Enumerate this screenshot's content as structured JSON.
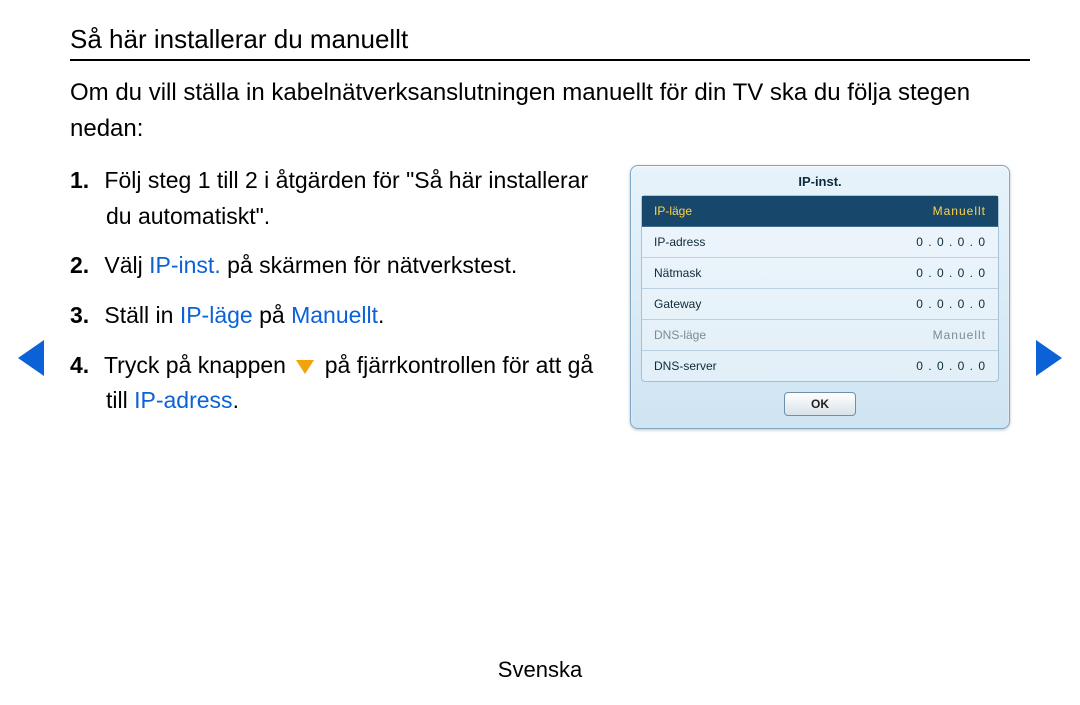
{
  "title": "Så här installerar du manuellt",
  "intro": "Om du vill ställa in kabelnätverksanslutningen manuellt för din TV ska du följja stegen nedan:",
  "intro_fixed": "Om du vill ställa in kabelnätverksanslutningen manuellt för din TV ska du följa stegen nedan:",
  "steps": {
    "s1": "Följ steg 1 till 2 i åtgärden för \"Så här installerar du automatiskt\".",
    "s2_pre": "Välj ",
    "s2_hl": "IP-inst.",
    "s2_post": " på skärmen för nätverkstest.",
    "s3_pre": "Ställ in ",
    "s3_hl1": "IP-läge",
    "s3_mid": " på ",
    "s3_hl2": "Manuellt",
    "s3_post": ".",
    "s4_pre": "Tryck på knappen ",
    "s4_mid": " på fjärrkontrollen för att gå till ",
    "s4_hl": "IP-adress",
    "s4_post": "."
  },
  "panel": {
    "title": "IP-inst.",
    "rows": [
      {
        "label": "IP-läge",
        "value": "Manuellt",
        "selected": true
      },
      {
        "label": "IP-adress",
        "value": "0 . 0 . 0 . 0"
      },
      {
        "label": "Nätmask",
        "value": "0 . 0 . 0 . 0"
      },
      {
        "label": "Gateway",
        "value": "0 . 0 . 0 . 0"
      },
      {
        "label": "DNS-läge",
        "value": "Manuellt",
        "dim": true
      },
      {
        "label": "DNS-server",
        "value": "0 . 0 . 0 . 0"
      }
    ],
    "ok": "OK"
  },
  "footer": "Svenska"
}
